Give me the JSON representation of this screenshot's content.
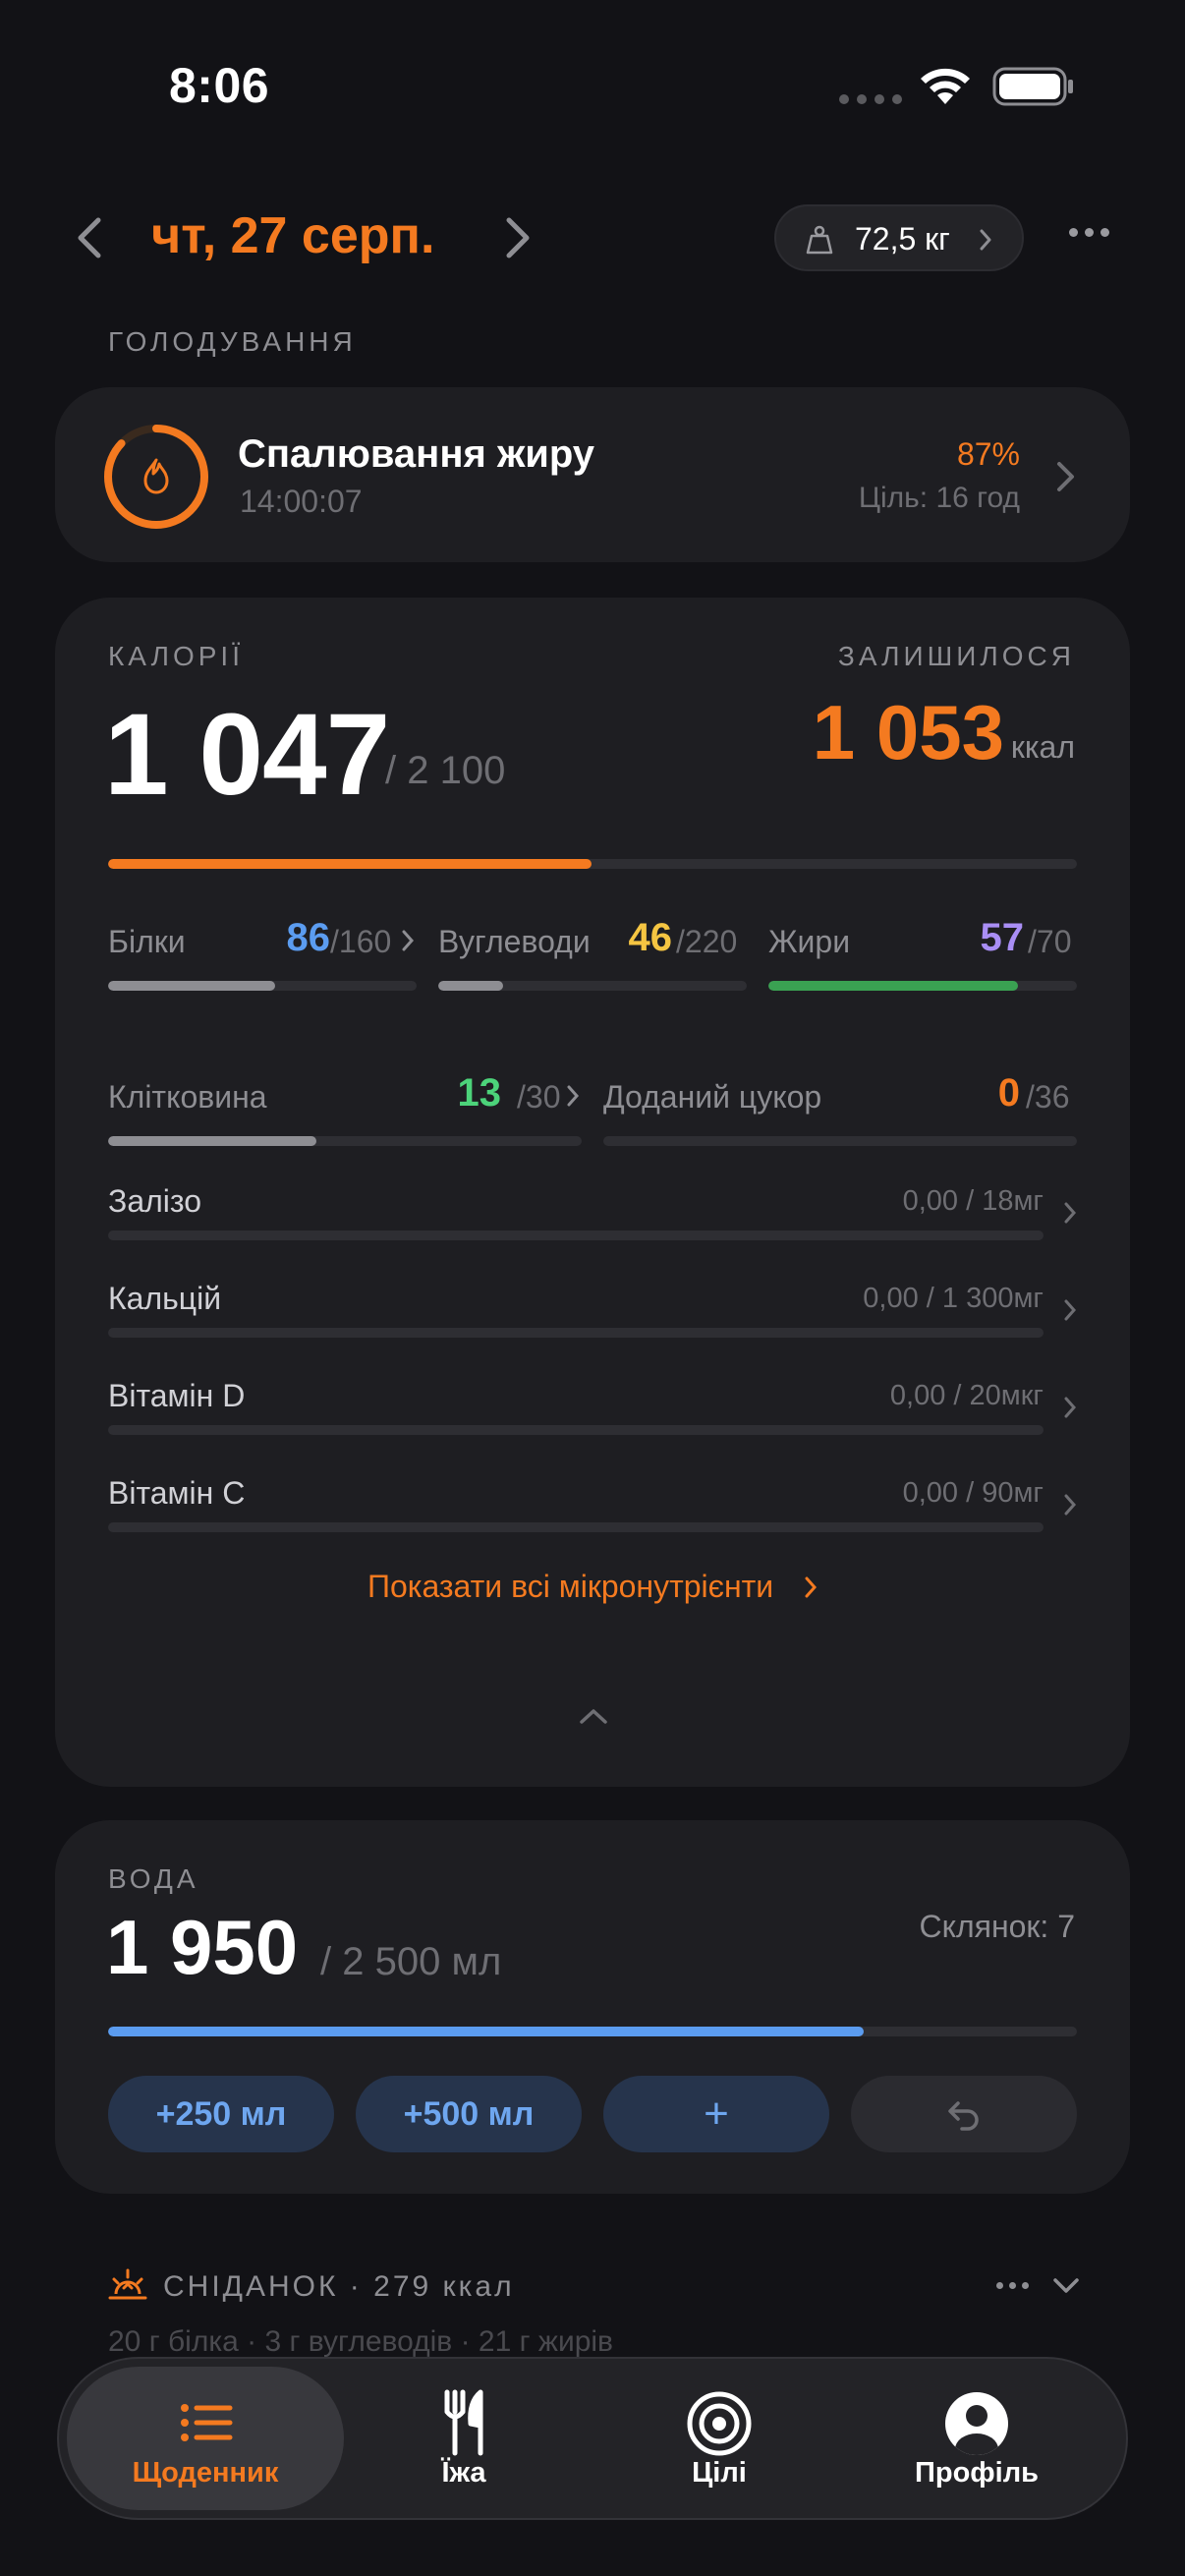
{
  "status_bar": {
    "time": "8:06"
  },
  "header": {
    "date": "чт, 27 серп.",
    "weight": "72,5 кг"
  },
  "fasting": {
    "section_label": "ГОЛОДУВАННЯ",
    "title": "Спалювання жиру",
    "elapsed": "14:00:07",
    "percent": "87%",
    "progress": 0.87,
    "goal": "Ціль: 16 год"
  },
  "calories": {
    "label": "КАЛОРІЇ",
    "remaining_label": "ЗАЛИШИЛОСЯ",
    "consumed": "1 047",
    "goal": "/ 2 100",
    "remaining": "1 053",
    "unit": "ккал",
    "progress": 0.4986
  },
  "macros": [
    {
      "name": "Білки",
      "value": "86",
      "goal": "/160",
      "progress": 0.54,
      "color": "#5b9cf0"
    },
    {
      "name": "Вуглеводи",
      "value": "46",
      "goal": "/220",
      "progress": 0.21,
      "color": "#f5c542"
    },
    {
      "name": "Жири",
      "value": "57",
      "goal": "/70",
      "progress": 0.81,
      "color": "#a98ef5"
    }
  ],
  "extras": [
    {
      "name": "Клітковина",
      "value": "13",
      "goal": "/30",
      "progress": 0.44,
      "color": "#4cd37a"
    },
    {
      "name": "Доданий цукор",
      "value": "0",
      "goal": "/36",
      "progress": 0.0,
      "color": "#f47a20"
    }
  ],
  "micros": [
    {
      "name": "Залізо",
      "value": "0,00 / 18мг"
    },
    {
      "name": "Кальцій",
      "value": "0,00 / 1 300мг"
    },
    {
      "name": "Вітамін D",
      "value": "0,00 / 20мкг"
    },
    {
      "name": "Вітамін С",
      "value": "0,00 / 90мг"
    }
  ],
  "show_all_label": "Показати всі мікронутрієнти",
  "water": {
    "label": "ВОДА",
    "value": "1 950",
    "goal": "/ 2 500 мл",
    "glasses": "Склянок: 7",
    "progress": 0.78,
    "buttons": [
      "+250 мл",
      "+500 мл",
      "+"
    ]
  },
  "breakfast": {
    "title": "СНІДАНОК · 279 ккал",
    "summary": "20 г білка · 3 г вуглеводів · 21 г жирів"
  },
  "tabs": [
    {
      "label": "Щоденник",
      "icon": "list-icon",
      "active": true
    },
    {
      "label": "Їжа",
      "icon": "fork-knife-icon",
      "active": false
    },
    {
      "label": "Цілі",
      "icon": "target-icon",
      "active": false
    },
    {
      "label": "Профіль",
      "icon": "profile-icon",
      "active": false
    }
  ],
  "colors": {
    "accent": "#f47a20",
    "water": "#5b9cf0",
    "card": "#1e1e22",
    "background": "#121216"
  }
}
